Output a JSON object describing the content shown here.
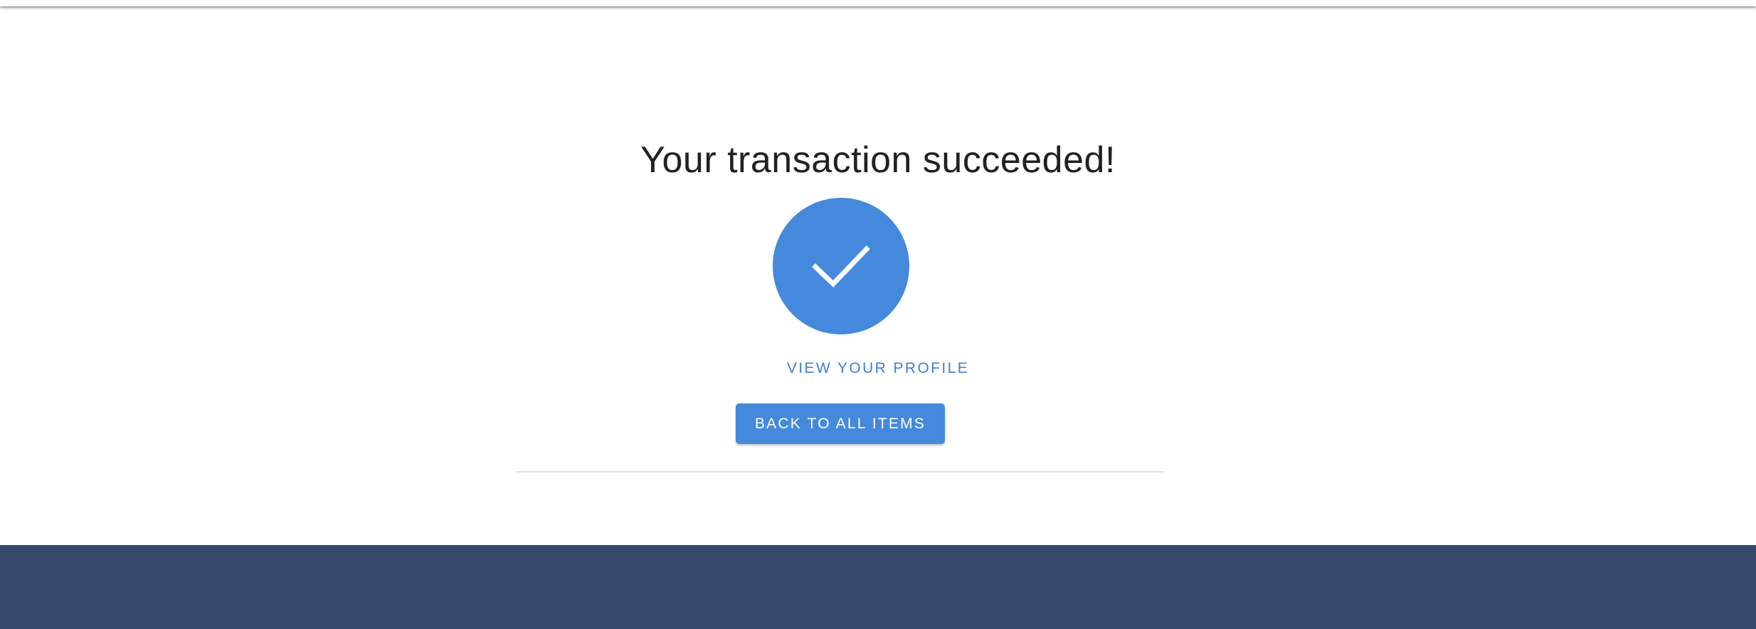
{
  "page": {
    "title": "Your transaction succeeded!",
    "status_icon": "check-icon",
    "accent_color": "#4589dc",
    "footer_color": "#36496d"
  },
  "actions": {
    "profile_link_label": "VIEW YOUR PROFILE",
    "back_button_label": "BACK TO ALL ITEMS"
  }
}
